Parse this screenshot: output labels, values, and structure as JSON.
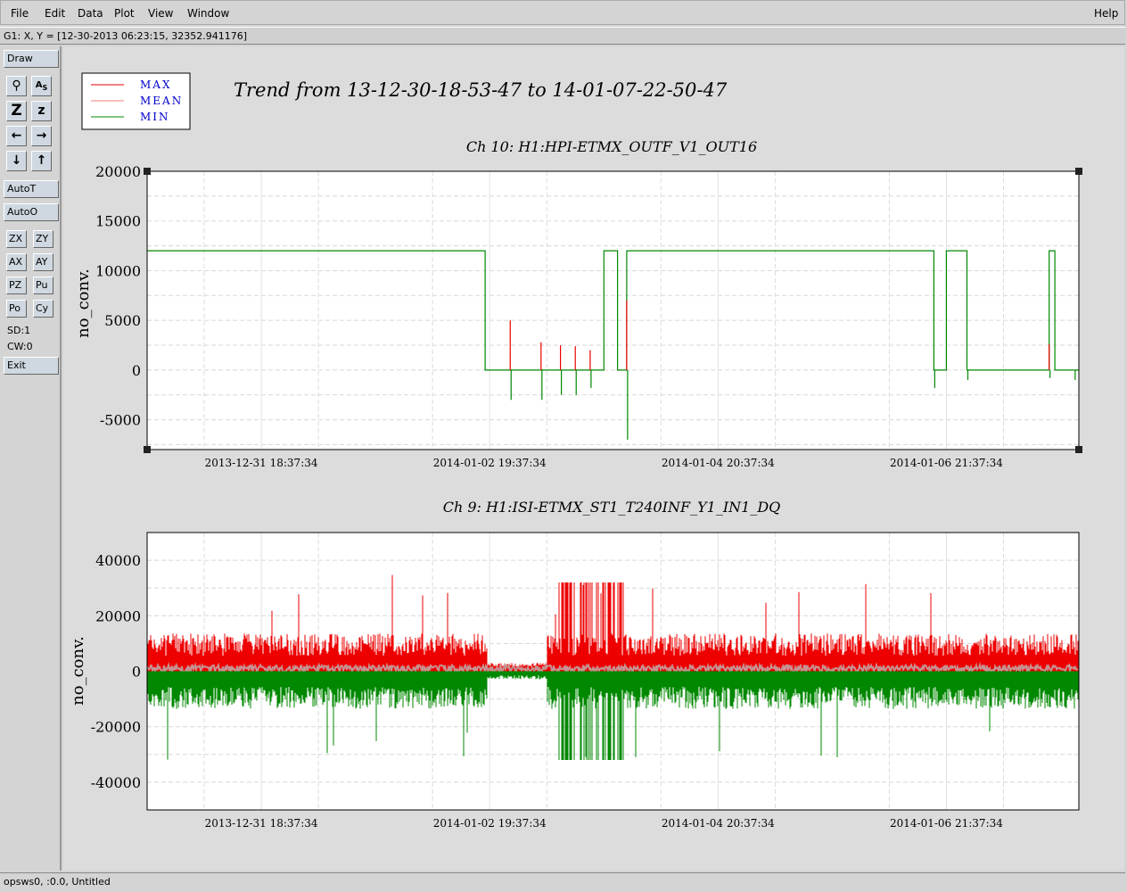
{
  "menubar": {
    "items": [
      "File",
      "Edit",
      "Data",
      "Plot",
      "View",
      "Window"
    ],
    "help": "Help"
  },
  "coord_readout": "G1: X, Y = [12-30-2013 06:23:15, 32352.941176]",
  "toolbar": {
    "draw": "Draw",
    "autot": "AutoT",
    "autoo": "AutoO",
    "small_buttons": [
      "ZX",
      "ZY",
      "AX",
      "AY",
      "PZ",
      "Pu",
      "Po",
      "Cy"
    ],
    "sd": "SD:1",
    "cw": "CW:0",
    "exit": "Exit",
    "icons": [
      "zoom-tool-icon",
      "text-tool-icon",
      "zoom-y-icon",
      "zoom-z-icon",
      "arrow-left-icon",
      "arrow-right-icon",
      "arrow-down-icon",
      "arrow-up-icon"
    ]
  },
  "legend": {
    "entries": [
      {
        "label": "MAX",
        "color": "#e00000"
      },
      {
        "label": "MEAN",
        "color": "#f08080"
      },
      {
        "label": "MIN",
        "color": "#008800"
      }
    ]
  },
  "plot_title": "Trend from 13-12-30-18-53-47 to 14-01-07-22-50-47",
  "status": "opsws0, :0.0, Untitled",
  "colors": {
    "max": "#ee0000",
    "mean": "#c89090",
    "min": "#008800"
  },
  "chart_data": [
    {
      "type": "line",
      "title": "Ch 10: H1:HPI-ETMX_OUTF_V1_OUT16",
      "ylabel": "no_conv.",
      "ylim": [
        -8000,
        20000
      ],
      "yticks": [
        20000,
        15000,
        10000,
        5000,
        0,
        -5000
      ],
      "xticks": [
        "2013-12-31 18:37:34",
        "2014-01-02 19:37:34",
        "2014-01-04 20:37:34",
        "2014-01-06 21:37:34"
      ],
      "xrange_days": [
        0,
        8.16
      ],
      "series": [
        {
          "name": "MIN",
          "x": [
            0,
            2.96,
            2.96,
            4.0,
            4.0,
            4.12,
            4.12,
            4.2,
            4.2,
            6.89,
            6.89,
            7.0,
            7.0,
            7.18,
            7.18,
            7.9,
            7.9,
            7.95,
            7.95,
            8.16
          ],
          "y": [
            12000,
            12000,
            0,
            0,
            12000,
            12000,
            0,
            0,
            12000,
            12000,
            0,
            0,
            12000,
            12000,
            0,
            0,
            12000,
            12000,
            0,
            0
          ]
        }
      ],
      "spikes": [
        {
          "x": 3.18,
          "max": 5000,
          "min": -3000
        },
        {
          "x": 3.45,
          "max": 2800,
          "min": -3000
        },
        {
          "x": 3.62,
          "max": 2500,
          "min": -2500
        },
        {
          "x": 3.75,
          "max": 2400,
          "min": -2500
        },
        {
          "x": 3.88,
          "max": 2000,
          "min": -1800
        },
        {
          "x": 4.2,
          "max": 7000,
          "min": -7000
        },
        {
          "x": 6.89,
          "max": 0,
          "min": -1800
        },
        {
          "x": 7.18,
          "max": 0,
          "min": -1000
        },
        {
          "x": 7.9,
          "max": 2600,
          "min": -800
        },
        {
          "x": 8.12,
          "max": 0,
          "min": -1000
        }
      ]
    },
    {
      "type": "line",
      "title": "Ch 9: H1:ISI-ETMX_ST1_T240INF_Y1_IN1_DQ",
      "ylabel": "no_conv.",
      "ylim": [
        -50000,
        50000
      ],
      "yticks": [
        40000,
        20000,
        0,
        -20000,
        -40000
      ],
      "xticks": [
        "2013-12-31 18:37:34",
        "2014-01-02 19:37:34",
        "2014-01-04 20:37:34",
        "2014-01-06 21:37:34"
      ],
      "xrange_days": [
        0,
        8.16
      ],
      "series": [
        {
          "name": "MAX",
          "approx_level": 8000
        },
        {
          "name": "MEAN",
          "approx_level": 1000
        },
        {
          "name": "MIN",
          "approx_level": -8000
        }
      ]
    }
  ]
}
